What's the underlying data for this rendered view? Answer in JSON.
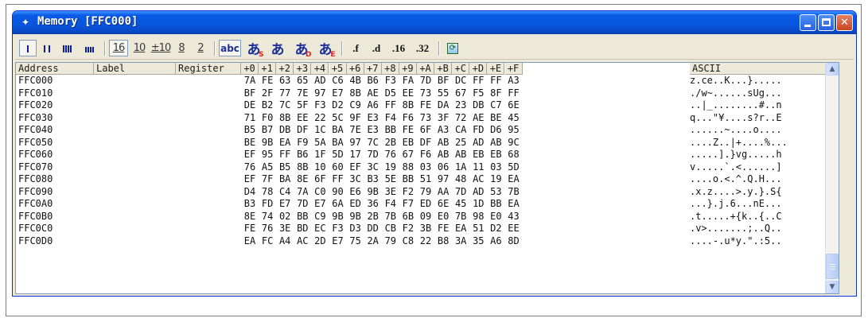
{
  "window": {
    "title": "Memory [FFC000]",
    "accent_color": "#0855dd"
  },
  "toolbar": {
    "width_buttons": [
      {
        "name": "byte-size-button",
        "icon": "one-bar-icon"
      },
      {
        "name": "word-size-button",
        "icon": "two-bar-icon"
      },
      {
        "name": "long-size-button",
        "icon": "four-bar-icon"
      },
      {
        "name": "quad-size-button",
        "icon": "eight-bar-icon"
      }
    ],
    "radix_buttons": [
      "16",
      "10",
      "±10",
      "8",
      "2"
    ],
    "text_buttons": [
      "abc",
      "あ",
      "あ",
      "あ",
      "あ"
    ],
    "format_buttons": [
      ".f",
      ".d",
      ".16",
      ".32"
    ],
    "refresh_icon": "refresh-icon"
  },
  "columns": {
    "address": "Address",
    "label": "Label",
    "register": "Register",
    "offsets": [
      "+0",
      "+1",
      "+2",
      "+3",
      "+4",
      "+5",
      "+6",
      "+7",
      "+8",
      "+9",
      "+A",
      "+B",
      "+C",
      "+D",
      "+E",
      "+F"
    ],
    "ascii": "ASCII"
  },
  "rows": [
    {
      "address": "FFC000",
      "bytes": [
        "7A",
        "FE",
        "63",
        "65",
        "AD",
        "C6",
        "4B",
        "B6",
        "F3",
        "FA",
        "7D",
        "BF",
        "DC",
        "FF",
        "FF",
        "A3"
      ],
      "ascii": "z.ce..K...}....."
    },
    {
      "address": "FFC010",
      "bytes": [
        "BF",
        "2F",
        "77",
        "7E",
        "97",
        "E7",
        "8B",
        "AE",
        "D5",
        "EE",
        "73",
        "55",
        "67",
        "F5",
        "8F",
        "FF"
      ],
      "ascii": "./w~......sUg..."
    },
    {
      "address": "FFC020",
      "bytes": [
        "DE",
        "B2",
        "7C",
        "5F",
        "F3",
        "D2",
        "C9",
        "A6",
        "FF",
        "8B",
        "FE",
        "DA",
        "23",
        "DB",
        "C7",
        "6E"
      ],
      "ascii": "..|_........#..n"
    },
    {
      "address": "FFC030",
      "bytes": [
        "71",
        "F0",
        "8B",
        "EE",
        "22",
        "5C",
        "9F",
        "E3",
        "F4",
        "F6",
        "73",
        "3F",
        "72",
        "AE",
        "BE",
        "45"
      ],
      "ascii": "q...\"¥....s?r..E"
    },
    {
      "address": "FFC040",
      "bytes": [
        "B5",
        "B7",
        "DB",
        "DF",
        "1C",
        "BA",
        "7E",
        "E3",
        "BB",
        "FE",
        "6F",
        "A3",
        "CA",
        "FD",
        "D6",
        "95"
      ],
      "ascii": "......~....o...."
    },
    {
      "address": "FFC050",
      "bytes": [
        "BE",
        "9B",
        "EA",
        "F9",
        "5A",
        "BA",
        "97",
        "7C",
        "2B",
        "EB",
        "DF",
        "AB",
        "25",
        "AD",
        "AB",
        "9C"
      ],
      "ascii": "....Z..|+....%..."
    },
    {
      "address": "FFC060",
      "bytes": [
        "EF",
        "95",
        "FF",
        "B6",
        "1F",
        "5D",
        "17",
        "7D",
        "76",
        "67",
        "F6",
        "AB",
        "AB",
        "EB",
        "EB",
        "68"
      ],
      "ascii": ".....].}vg.....h"
    },
    {
      "address": "FFC070",
      "bytes": [
        "76",
        "A5",
        "B5",
        "8B",
        "10",
        "60",
        "EF",
        "3C",
        "19",
        "88",
        "03",
        "06",
        "1A",
        "11",
        "03",
        "5D"
      ],
      "ascii": "v.....`.<......]"
    },
    {
      "address": "FFC080",
      "bytes": [
        "EF",
        "7F",
        "BA",
        "8E",
        "6F",
        "FF",
        "3C",
        "B3",
        "5E",
        "BB",
        "51",
        "97",
        "48",
        "AC",
        "19",
        "EA"
      ],
      "ascii": "....o.<.^.Q.H..."
    },
    {
      "address": "FFC090",
      "bytes": [
        "D4",
        "78",
        "C4",
        "7A",
        "C0",
        "90",
        "E6",
        "9B",
        "3E",
        "F2",
        "79",
        "AA",
        "7D",
        "AD",
        "53",
        "7B"
      ],
      "ascii": ".x.z....>.y.}.S{"
    },
    {
      "address": "FFC0A0",
      "bytes": [
        "B3",
        "FD",
        "E7",
        "7D",
        "E7",
        "6A",
        "ED",
        "36",
        "F4",
        "F7",
        "ED",
        "6E",
        "45",
        "1D",
        "BB",
        "EA"
      ],
      "ascii": "...}.j.6...nE..."
    },
    {
      "address": "FFC0B0",
      "bytes": [
        "8E",
        "74",
        "02",
        "BB",
        "C9",
        "9B",
        "9B",
        "2B",
        "7B",
        "6B",
        "09",
        "E0",
        "7B",
        "98",
        "E0",
        "43"
      ],
      "ascii": ".t.....+{k..{..C"
    },
    {
      "address": "FFC0C0",
      "bytes": [
        "FE",
        "76",
        "3E",
        "BD",
        "EC",
        "F3",
        "D3",
        "DD",
        "CB",
        "F2",
        "3B",
        "FE",
        "EA",
        "51",
        "D2",
        "EE"
      ],
      "ascii": ".v>.......;..Q.."
    },
    {
      "address": "FFC0D0",
      "bytes": [
        "EA",
        "FC",
        "A4",
        "AC",
        "2D",
        "E7",
        "75",
        "2A",
        "79",
        "C8",
        "22",
        "B8",
        "3A",
        "35",
        "A6",
        "8D"
      ],
      "ascii": "....-.u*y.\".:5.."
    }
  ]
}
